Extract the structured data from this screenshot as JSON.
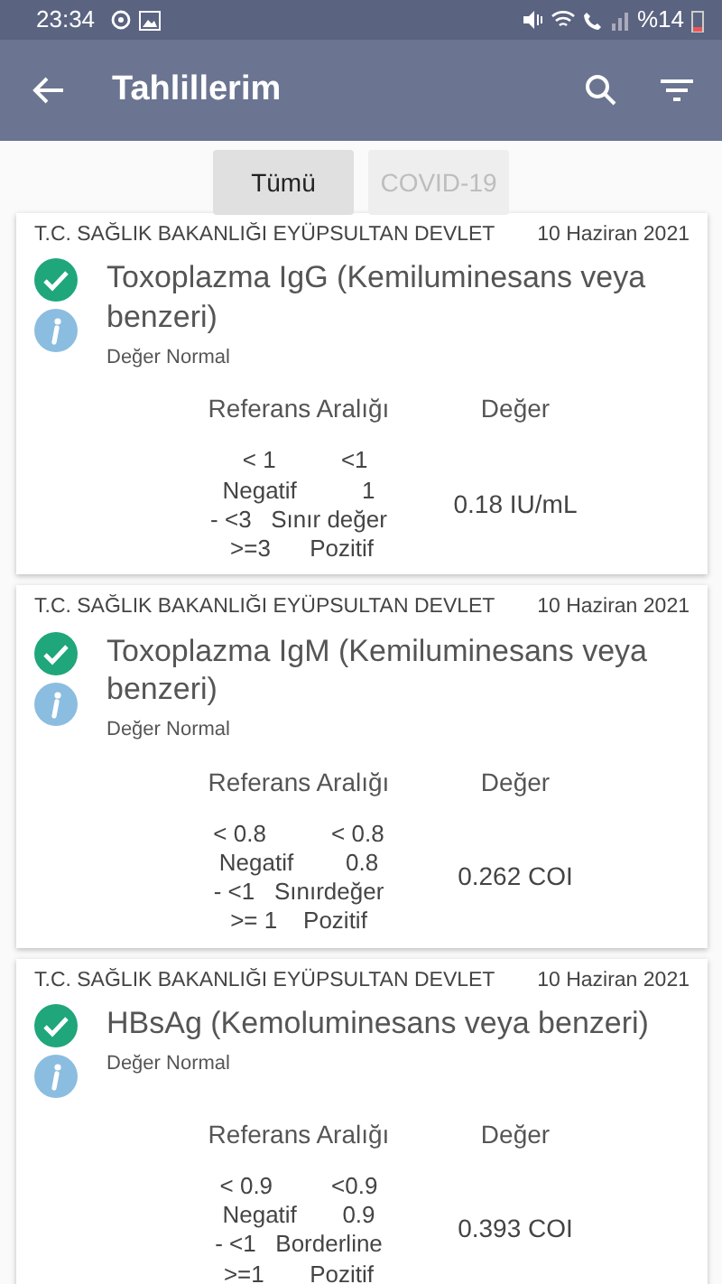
{
  "status_bar": {
    "time": "23:34",
    "battery": "%14"
  },
  "app_bar": {
    "title": "Tahlillerim"
  },
  "filters": [
    {
      "label": "Tümü",
      "selected": true
    },
    {
      "label": "COVID-19",
      "selected": false
    }
  ],
  "results": [
    {
      "institution": "T.C. SAĞLIK BAKANLIĞI EYÜPSULTAN DEVLET",
      "date": "10 Haziran 2021",
      "test": "Toxoplazma IgG (Kemiluminesans veya benzeri)",
      "status": "Değer Normal",
      "normal": true,
      "range_heading": "Referans Aralığı",
      "value_heading": "Değer",
      "range_lines": [
        "  < 1          <1",
        "Negatif          1",
        "- <3   Sınır değer",
        " >=3      Pozitif"
      ],
      "value": "0.18 IU/mL"
    },
    {
      "institution": "T.C. SAĞLIK BAKANLIĞI EYÜPSULTAN DEVLET",
      "date": "10 Haziran 2021",
      "test": "Toxoplazma IgM (Kemiluminesans veya benzeri)",
      "status": "Değer Normal",
      "normal": true,
      "range_heading": "Referans Aralığı",
      "value_heading": "Değer",
      "range_lines": [
        "< 0.8          < 0.8",
        "Negatif        0.8",
        "- <1   Sınırdeğer",
        ">= 1    Pozitif"
      ],
      "value": "0.262 COI"
    },
    {
      "institution": "T.C. SAĞLIK BAKANLIĞI EYÜPSULTAN DEVLET",
      "date": "10 Haziran 2021",
      "test": "HBsAg (Kemoluminesans veya benzeri)",
      "status": "Değer Normal",
      "normal": true,
      "range_heading": "Referans Aralığı",
      "value_heading": "Değer",
      "range_lines": [
        "< 0.9         <0.9",
        "Negatif       0.9",
        "- <1   Borderline",
        ">=1       Pozitif"
      ],
      "value": "0.393 COI"
    }
  ]
}
